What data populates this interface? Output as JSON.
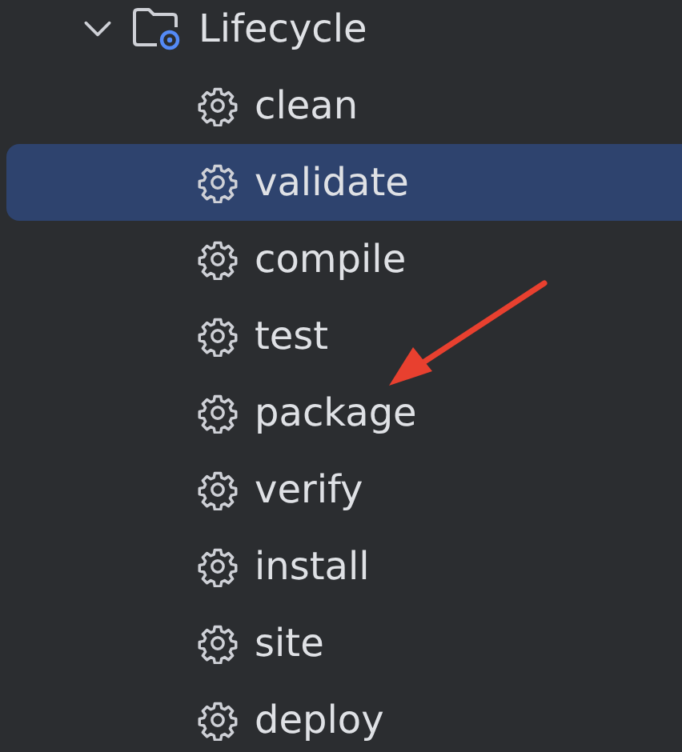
{
  "tree": {
    "label": "Lifecycle",
    "expanded": true,
    "children": [
      {
        "label": "clean",
        "selected": false
      },
      {
        "label": "validate",
        "selected": true
      },
      {
        "label": "compile",
        "selected": false
      },
      {
        "label": "test",
        "selected": false
      },
      {
        "label": "package",
        "selected": false
      },
      {
        "label": "verify",
        "selected": false
      },
      {
        "label": "install",
        "selected": false
      },
      {
        "label": "site",
        "selected": false
      },
      {
        "label": "deploy",
        "selected": false
      }
    ]
  }
}
